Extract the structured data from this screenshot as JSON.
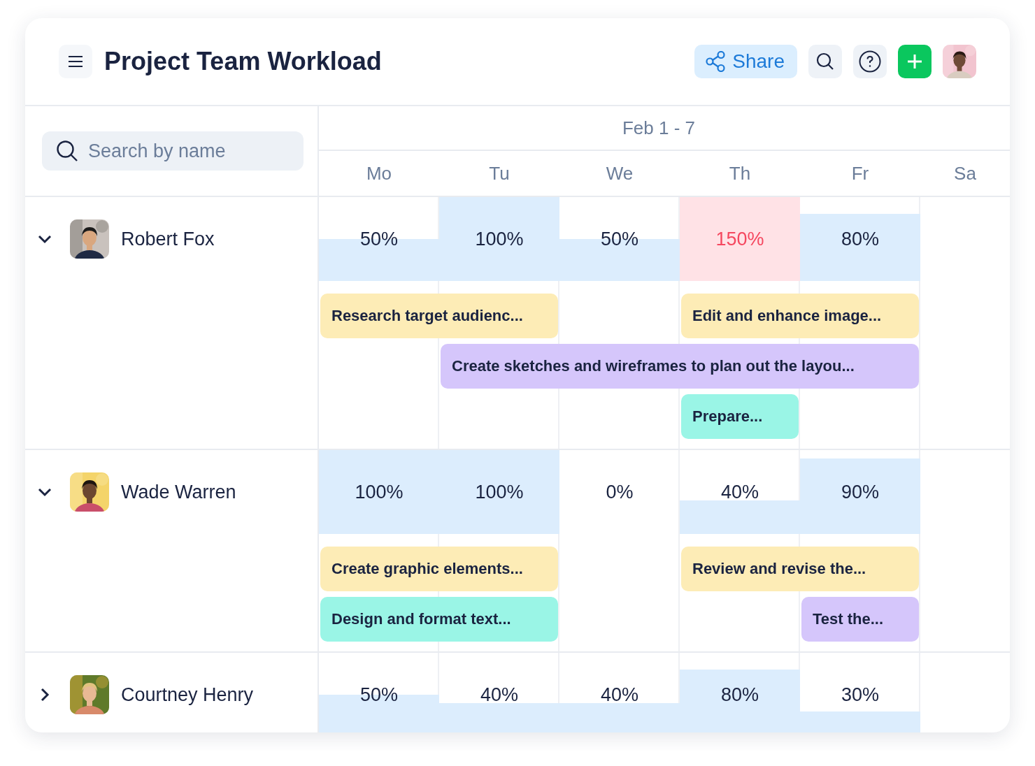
{
  "header": {
    "title": "Project Team Workload",
    "share_label": "Share",
    "user_avatar": {
      "kind": "picture"
    }
  },
  "search": {
    "placeholder": "Search by name"
  },
  "week": {
    "label": "Feb 1 - 7",
    "days": [
      "Mo",
      "Tu",
      "We",
      "Th",
      "Fr",
      "Sa"
    ]
  },
  "people": [
    {
      "name": "Robert Fox",
      "expanded": true,
      "avatar": {
        "kind": "picture"
      },
      "loads": [
        {
          "text": "50%",
          "overloaded": false
        },
        {
          "text": "100%",
          "overloaded": false
        },
        {
          "text": "50%",
          "overloaded": false
        },
        {
          "text": "150%",
          "overloaded": true
        },
        {
          "text": "80%",
          "overloaded": false
        }
      ],
      "lanes": [
        [
          {
            "kind": "task",
            "label": "Research target audienc...",
            "color": "#fdecb6"
          },
          {
            "kind": "continued"
          },
          {
            "kind": "empty"
          },
          {
            "kind": "task",
            "label": "Edit and enhance image...",
            "color": "#fdecb6"
          },
          {
            "kind": "continued"
          },
          {
            "kind": "empty"
          }
        ],
        [
          {
            "kind": "empty"
          },
          {
            "kind": "task",
            "label": "Create sketches and wireframes to plan out the layou...",
            "color": "#d5c6fb"
          },
          {
            "kind": "continued"
          },
          {
            "kind": "continued"
          },
          {
            "kind": "continued"
          },
          {
            "kind": "empty"
          }
        ],
        [
          {
            "kind": "empty"
          },
          {
            "kind": "empty"
          },
          {
            "kind": "empty"
          },
          {
            "kind": "task",
            "label": "Prepare...",
            "color": "#9af5e6"
          },
          {
            "kind": "empty"
          },
          {
            "kind": "empty"
          }
        ]
      ]
    },
    {
      "name": "Wade Warren",
      "expanded": true,
      "avatar": {
        "kind": "picture"
      },
      "loads": [
        {
          "text": "100%",
          "overloaded": false
        },
        {
          "text": "100%",
          "overloaded": false
        },
        {
          "text": "0%",
          "overloaded": false
        },
        {
          "text": "40%",
          "overloaded": false
        },
        {
          "text": "90%",
          "overloaded": false
        }
      ],
      "lanes": [
        [
          {
            "kind": "task",
            "label": "Create graphic elements...",
            "color": "#fdecb6"
          },
          {
            "kind": "continued"
          },
          {
            "kind": "empty"
          },
          {
            "kind": "task",
            "label": "Review and revise the...",
            "color": "#fdecb6"
          },
          {
            "kind": "continued"
          },
          {
            "kind": "empty"
          }
        ],
        [
          {
            "kind": "task",
            "label": "Design and format text...",
            "color": "#9af5e6"
          },
          {
            "kind": "continued"
          },
          {
            "kind": "empty"
          },
          {
            "kind": "empty"
          },
          {
            "kind": "task",
            "label": "Test the...",
            "color": "#d5c6fb"
          },
          {
            "kind": "empty"
          }
        ]
      ]
    },
    {
      "name": "Courtney Henry",
      "expanded": false,
      "avatar": {
        "kind": "picture"
      },
      "loads": [
        {
          "text": "50%",
          "overloaded": false
        },
        {
          "text": "40%",
          "overloaded": false
        },
        {
          "text": "40%",
          "overloaded": false
        },
        {
          "text": "80%",
          "overloaded": false
        },
        {
          "text": "30%",
          "overloaded": false
        }
      ]
    }
  ]
}
